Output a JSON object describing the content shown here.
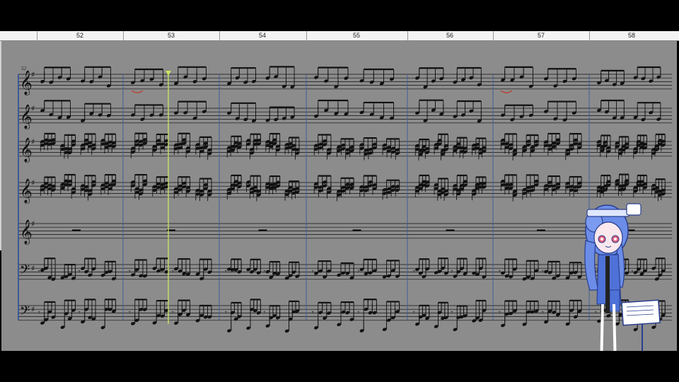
{
  "window": {
    "ruler_measures": [
      "52",
      "53",
      "54",
      "55",
      "56",
      "57",
      "58"
    ],
    "system_start_measure": "52"
  },
  "colors": {
    "background": "#000000",
    "ruler": "#f3f3f3",
    "score_background": "#8c8c8c",
    "notation": "#111111",
    "barline_blue": "#3d5a9a",
    "playhead": "#c8e860",
    "slur_red": "#c0392b",
    "mascot_blue": "#5a7fe0"
  },
  "staves": [
    {
      "clef": "treble",
      "key": "G major",
      "role": "melody-1"
    },
    {
      "clef": "treble",
      "key": "G major",
      "role": "melody-2"
    },
    {
      "clef": "treble",
      "key": "G major",
      "role": "chords-1"
    },
    {
      "clef": "treble",
      "key": "G major",
      "role": "chords-2"
    },
    {
      "clef": "treble",
      "key": "G major",
      "role": "rest-whole"
    },
    {
      "clef": "bass",
      "key": "G major",
      "role": "bass-chords"
    },
    {
      "clef": "bass",
      "key": "G major",
      "role": "bass-line"
    }
  ],
  "icons": {
    "mascot": "chibi-girl-with-music-stand-icon",
    "playhead": "playhead-marker-icon",
    "treble_clef": "treble-clef-icon",
    "bass_clef": "bass-clef-icon"
  }
}
